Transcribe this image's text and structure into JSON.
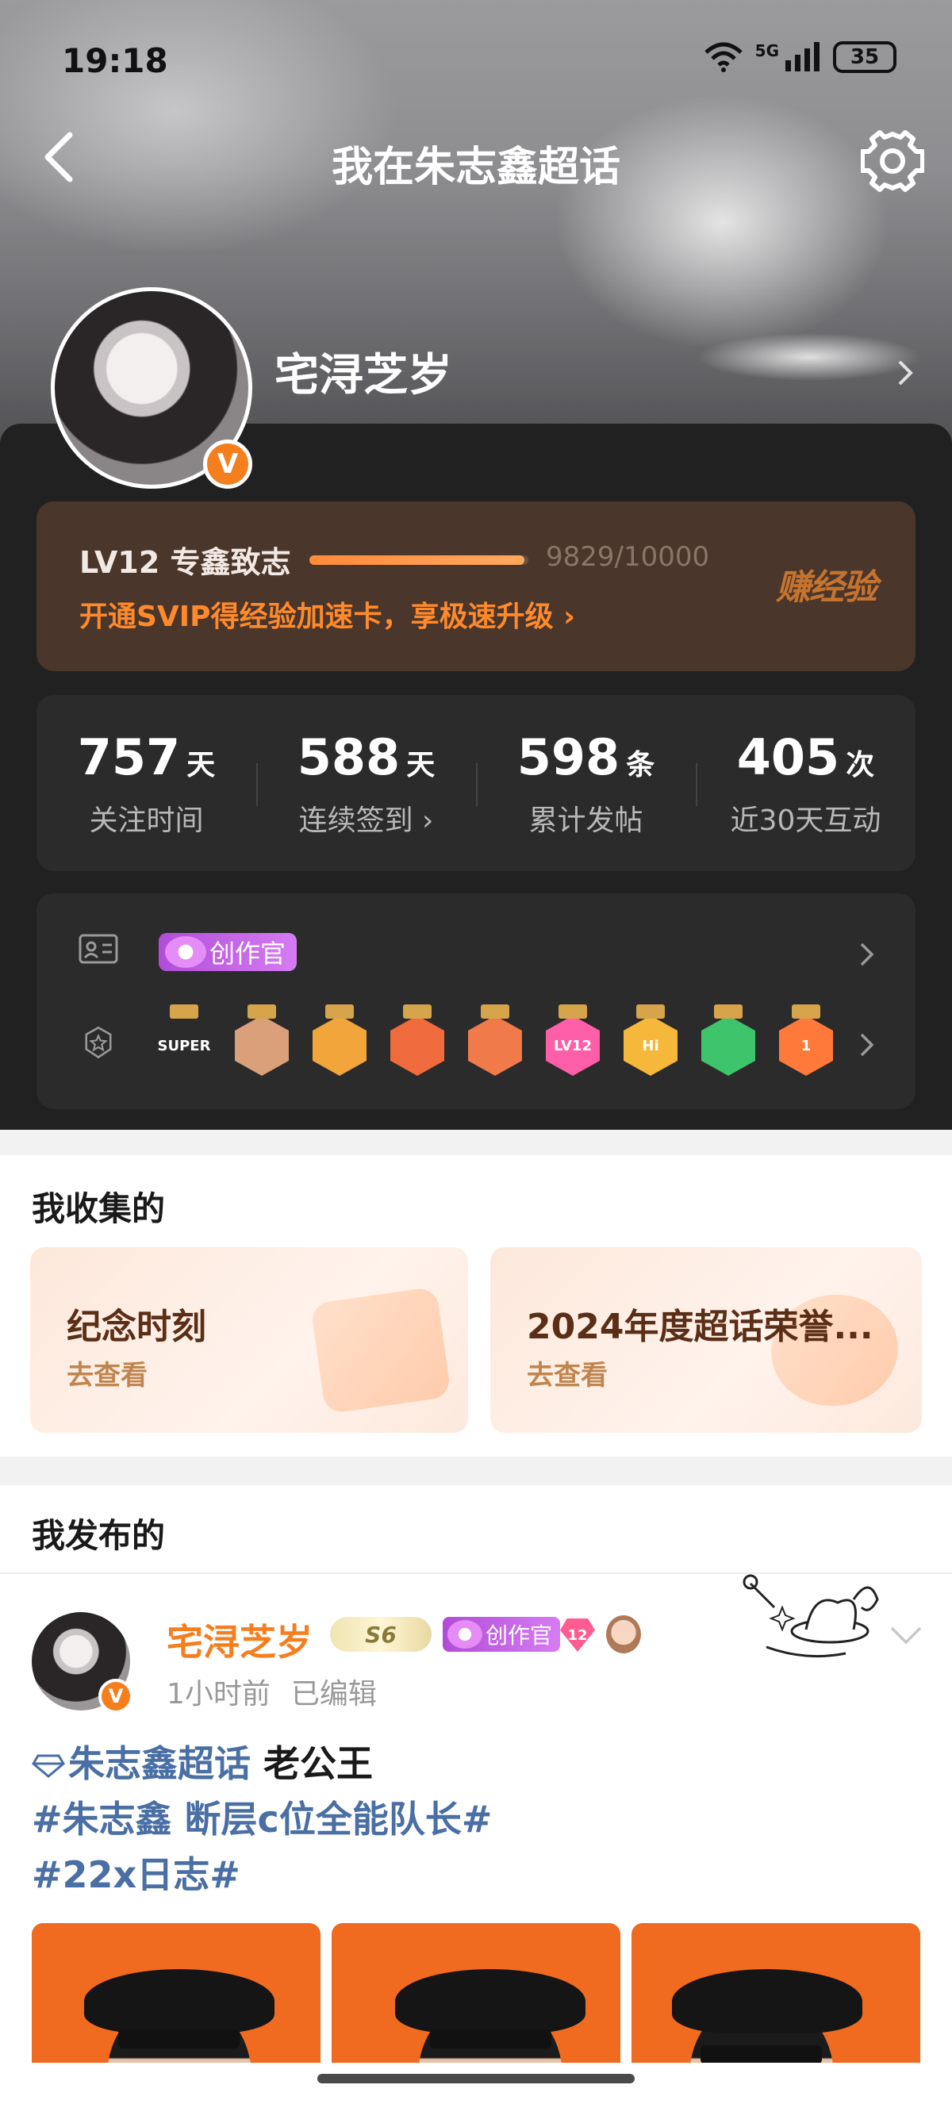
{
  "status_bar": {
    "time": "19:18",
    "network": "5G",
    "battery": "35"
  },
  "nav": {
    "title": "我在朱志鑫超话"
  },
  "profile": {
    "username": "宅浔芝岁",
    "verified_badge": "V"
  },
  "level": {
    "name": "LV12 专鑫致志",
    "progress_text": "9829/10000",
    "progress_fraction": 0.9829,
    "promo": "开通SVIP得经验加速卡，享极速升级 ›",
    "earn_label": "赚经验"
  },
  "stats": [
    {
      "num": "757",
      "unit": "天",
      "label": "关注时间"
    },
    {
      "num": "588",
      "unit": "天",
      "label": "连续签到 ›"
    },
    {
      "num": "598",
      "unit": "条",
      "label": "累计发帖"
    },
    {
      "num": "405",
      "unit": "次",
      "label": "近30天互动"
    }
  ],
  "identity": {
    "creator_tag": "创作官"
  },
  "badges": [
    {
      "name": "super-badge",
      "text": "SUPER",
      "color": "#2b2b2b"
    },
    {
      "name": "avatar-badge",
      "text": "",
      "color": "#d9a07a"
    },
    {
      "name": "crown-badge",
      "text": "",
      "color": "#f2a53a"
    },
    {
      "name": "cat-badge-1",
      "text": "",
      "color": "#ef6a3c"
    },
    {
      "name": "cat-badge-2",
      "text": "",
      "color": "#f07a4a"
    },
    {
      "name": "lv12-badge",
      "text": "LV12",
      "color": "#ff5ea8"
    },
    {
      "name": "hi-badge",
      "text": "Hi",
      "color": "#f6b83a"
    },
    {
      "name": "hand-badge",
      "text": "",
      "color": "#3ec46a"
    },
    {
      "name": "partial-badge",
      "text": "1",
      "color": "#ff7a3a"
    }
  ],
  "collect": {
    "title": "我收集的",
    "cards": [
      {
        "title": "纪念时刻",
        "sub": "去查看"
      },
      {
        "title": "2024年度超话荣誉...",
        "sub": "去查看"
      }
    ]
  },
  "posted": {
    "title": "我发布的",
    "post": {
      "author": "宅浔芝岁",
      "level_badge": "S6",
      "creator_tag": "创作官",
      "lv_gem": "12",
      "time": "1小时前",
      "edited": "已编辑",
      "topic": "朱志鑫超话",
      "text_after_topic": " 老公王",
      "hashtag1": "#朱志鑫 断层c位全能队长#",
      "hashtag2": "#22x日志#"
    }
  },
  "colors": {
    "accent": "#f57e1f",
    "link": "#4a6fa5",
    "dark_card": "#212121",
    "level_card": "#4a362b"
  }
}
